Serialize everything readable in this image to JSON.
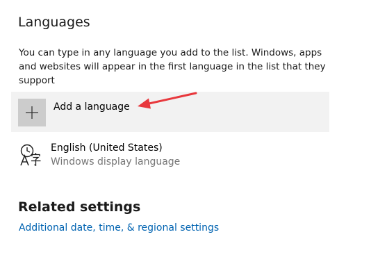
{
  "languages": {
    "title": "Languages",
    "description": "You can type in any language you add to the list. Windows, apps and websites will appear in the first language in the list that they support",
    "add_button": {
      "label": "Add a language",
      "icon": "plus-icon"
    },
    "items": [
      {
        "name": "English (United States)",
        "subtitle": "Windows display language",
        "icon": "language-icon"
      }
    ]
  },
  "related": {
    "title": "Related settings",
    "links": [
      {
        "label": "Additional date, time, & regional settings"
      }
    ]
  },
  "annotation": {
    "icon": "red-arrow-icon",
    "color": "#e8383d"
  },
  "colors": {
    "accent_link": "#0063b1",
    "add_tile_background": "#f2f2f2",
    "add_icon_background": "#cccccc",
    "secondary_text": "#767676"
  }
}
